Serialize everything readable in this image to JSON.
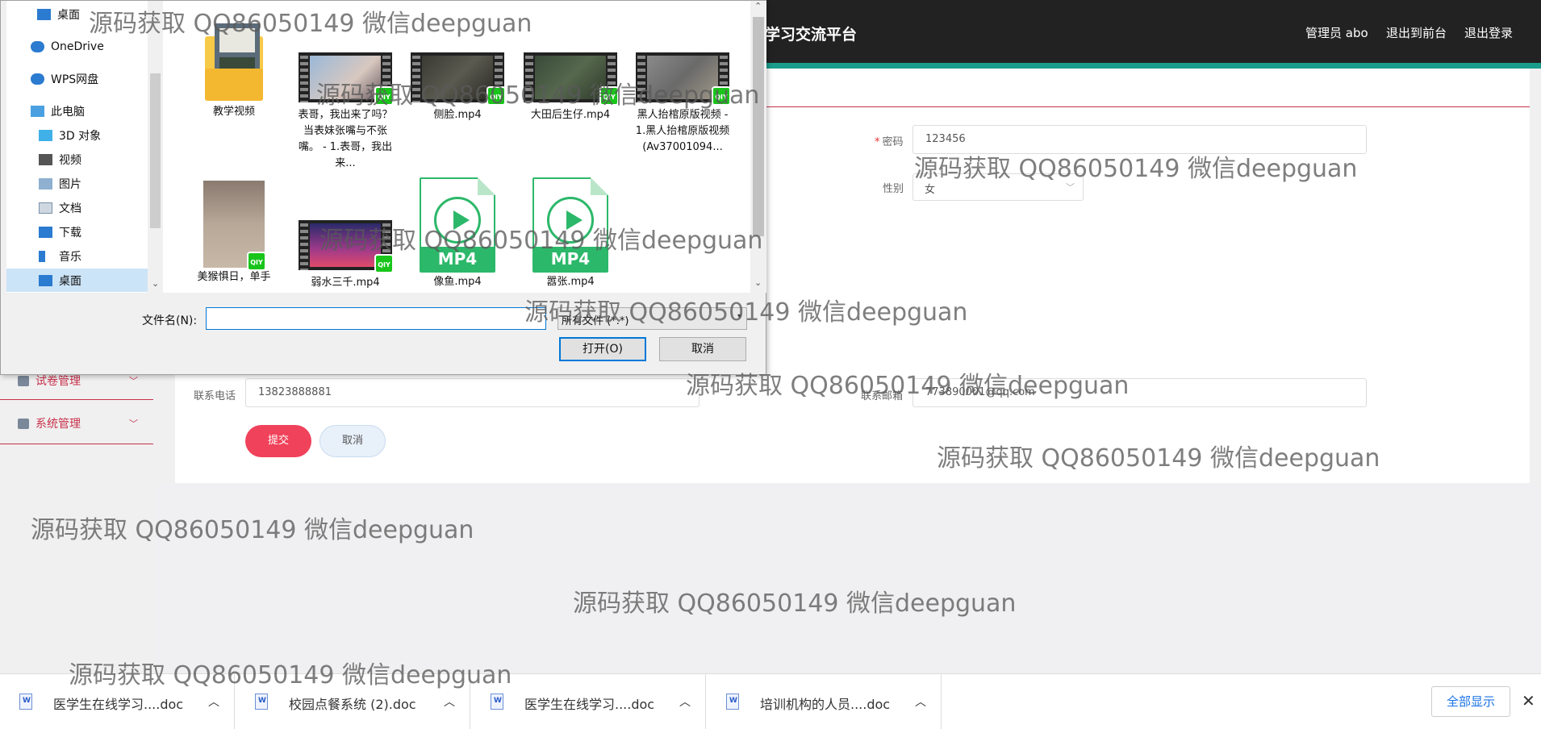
{
  "site": {
    "title": "学习交流平台",
    "admin_label": "管理员 abo",
    "front_link": "退出到前台",
    "logout_link": "退出登录"
  },
  "sidebar": {
    "items": [
      {
        "label": "试卷管理",
        "icon": "person-icon"
      },
      {
        "label": "系统管理",
        "icon": "settings-icon"
      }
    ]
  },
  "form": {
    "password_label": "密码",
    "password_value": "123456",
    "gender_label": "性别",
    "gender_value": "女",
    "phone_label": "联系电话",
    "phone_value": "13823888881",
    "email_label": "联系邮箱",
    "email_value": "773890001@qq.com",
    "submit_label": "提交",
    "cancel_label": "取消"
  },
  "dialog": {
    "nav_items": [
      {
        "label": "桌面",
        "icon": "desktop-icon"
      },
      {
        "label": "OneDrive",
        "icon": "cloud-icon"
      },
      {
        "label": "WPS网盘",
        "icon": "wps-cloud-icon"
      },
      {
        "label": "此电脑",
        "icon": "computer-icon"
      },
      {
        "label": "3D 对象",
        "icon": "cube-icon"
      },
      {
        "label": "视频",
        "icon": "video-folder-icon"
      },
      {
        "label": "图片",
        "icon": "picture-folder-icon"
      },
      {
        "label": "文档",
        "icon": "document-folder-icon"
      },
      {
        "label": "下载",
        "icon": "download-icon"
      },
      {
        "label": "音乐",
        "icon": "music-icon"
      },
      {
        "label": "桌面",
        "icon": "desktop-icon"
      }
    ],
    "files": [
      {
        "name": "教学视频",
        "type": "folder"
      },
      {
        "name": "表哥，我出来了吗？ 当表妹张嘴与不张嘴。 - 1.表哥，我出来...",
        "type": "video"
      },
      {
        "name": "侧脸.mp4",
        "type": "video"
      },
      {
        "name": "大田后生仔.mp4",
        "type": "video"
      },
      {
        "name": "黑人抬棺原版视频 - 1.黑人抬棺原版视频(Av37001094...",
        "type": "video"
      },
      {
        "name": "美猴惧日，单手",
        "type": "image"
      },
      {
        "name": "弱水三千.mp4",
        "type": "video"
      },
      {
        "name": "像鱼.mp4",
        "type": "mp4"
      },
      {
        "name": "嚣张.mp4",
        "type": "mp4"
      }
    ],
    "filename_label": "文件名(N):",
    "filename_value": "",
    "filetype_value": "所有文件 (*.*)",
    "open_label": "打开(O)",
    "cancel_label": "取消"
  },
  "downloads": {
    "items": [
      {
        "name": "医学生在线学习....doc"
      },
      {
        "name": "校园点餐系统 (2).doc"
      },
      {
        "name": "医学生在线学习....doc"
      },
      {
        "name": "培训机构的人员....doc"
      }
    ],
    "show_all_label": "全部显示"
  },
  "watermark": "源码获取 QQ86050149 微信deepguan",
  "colors": {
    "accent": "#1a9c8c",
    "danger": "#f0425a",
    "selection": "#cce4f7",
    "mp4_green": "#2cb86a"
  }
}
